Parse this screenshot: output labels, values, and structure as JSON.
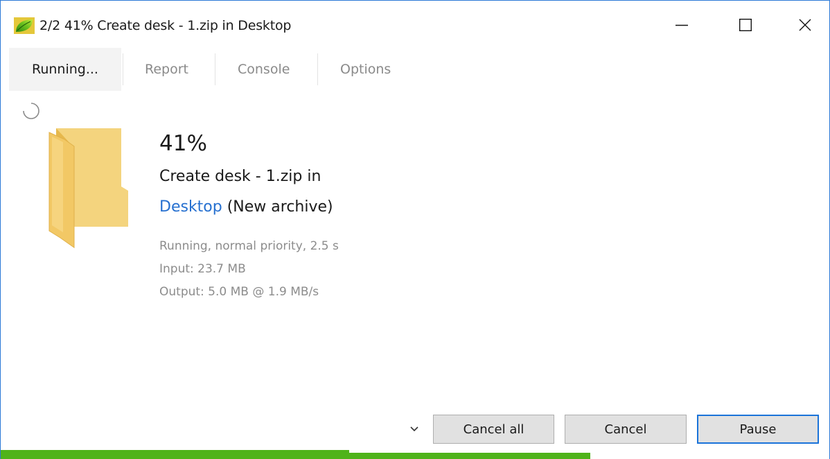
{
  "window": {
    "title": "2/2 41% Create desk - 1.zip in Desktop",
    "icons": {
      "app": "peazip-leaf-icon",
      "minimize": "minimize-icon",
      "maximize": "maximize-icon",
      "close": "close-icon"
    }
  },
  "tabs": [
    {
      "label": "Running...",
      "active": true
    },
    {
      "label": "Report",
      "active": false
    },
    {
      "label": "Console",
      "active": false
    },
    {
      "label": "Options",
      "active": false
    }
  ],
  "job": {
    "percent": "41%",
    "action": "Create desk - 1.zip in",
    "target_link": "Desktop",
    "target_note": " (New archive)",
    "status": "Running, normal priority, 2.5 s",
    "input": "Input: 23.7 MB",
    "output": "Output: 5.0 MB @ 1.9 MB/s",
    "item_icon": "folder-icon",
    "spinner_icon": "spinner-icon"
  },
  "buttons": {
    "dropdown_icon": "chevron-down-icon",
    "cancel_all": "Cancel all",
    "cancel": "Cancel",
    "pause": "Pause"
  },
  "progress": {
    "primary_fraction": 0.42,
    "secondary_fraction": 0.71,
    "color": "#4fb31a"
  },
  "colors": {
    "accent": "#1a73d9",
    "link": "#2670d0",
    "window_border": "#2b79d7"
  }
}
